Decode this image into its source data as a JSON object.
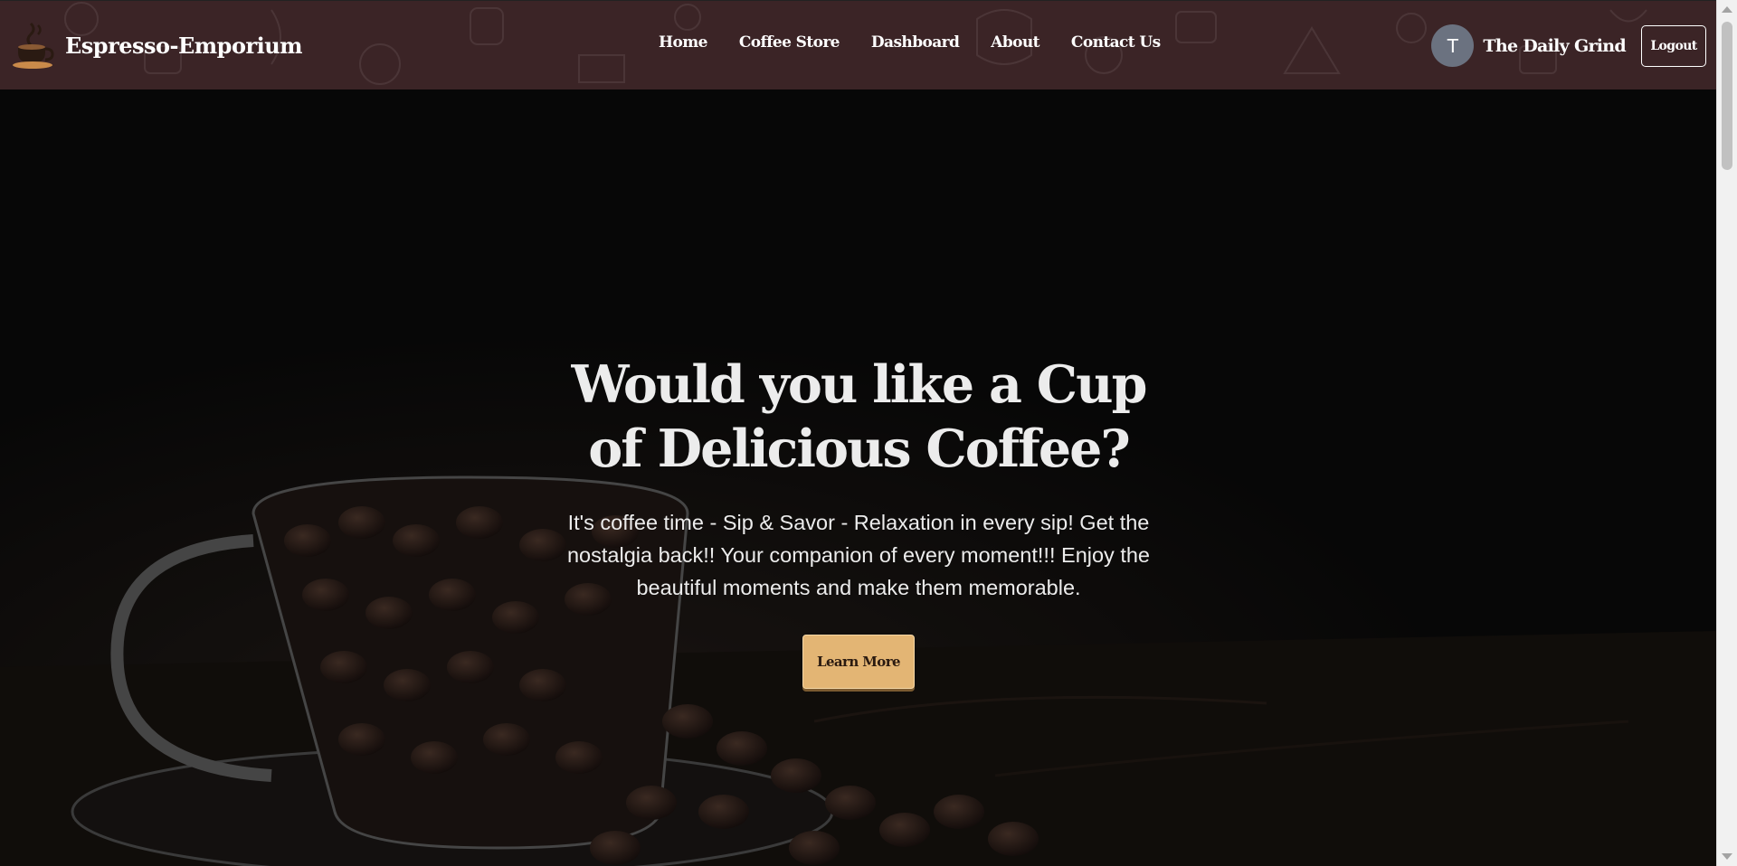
{
  "brand": {
    "name": "Espresso-Emporium",
    "logo_icon": "coffee-cup-logo-icon"
  },
  "nav": {
    "links": [
      {
        "label": "Home"
      },
      {
        "label": "Coffee Store"
      },
      {
        "label": "Dashboard"
      },
      {
        "label": "About"
      },
      {
        "label": "Contact Us"
      }
    ]
  },
  "user": {
    "avatar_initial": "T",
    "name": "The Daily Grind",
    "logout_label": "Logout"
  },
  "hero": {
    "title": "Would you like a Cup of Delicious Coffee?",
    "description": "It's coffee time - Sip & Savor - Relaxation in every sip! Get the nostalgia back!! Your companion of every moment!!! Enjoy the beautiful moments and make them memorable.",
    "cta_label": "Learn More",
    "background_icon": "coffee-beans-glass-cup-image"
  },
  "colors": {
    "navbar_bg": "#3b2426",
    "hero_bg": "#0b0b0b",
    "cta_bg": "#e3b574",
    "avatar_bg": "#6b7280",
    "text_light": "#ececec"
  }
}
